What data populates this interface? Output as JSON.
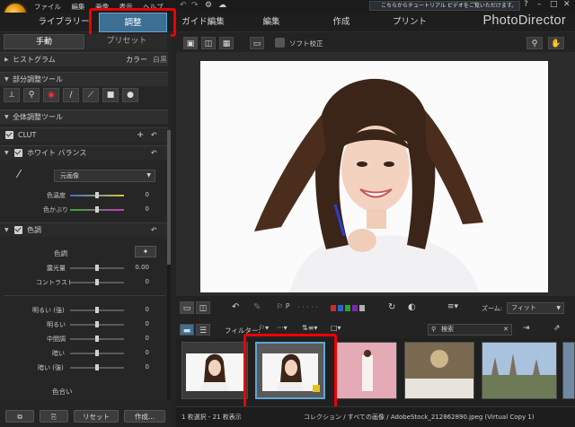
{
  "menu": [
    "ファイル",
    "編集",
    "画像",
    "表示",
    "ヘルプ"
  ],
  "tip": "こちらからチュートリアル ビデオをご覧いただけます。",
  "nav": [
    "ライブラリー",
    "調整",
    "ガイド編集",
    "編集",
    "作成",
    "プリント"
  ],
  "brand": "PhotoDirector",
  "left": {
    "tabs": [
      "手動",
      "プリセット"
    ],
    "histogram": {
      "title": "ヒストグラム",
      "opt1": "カラー",
      "opt2": "白黒"
    },
    "local_tools": "部分調整ツール",
    "global_tools": "全体調整ツール",
    "clut": "CLUT",
    "wb": {
      "title": "ホワイト バランス",
      "preset": "元画像",
      "temp": "色温度",
      "tint": "色かぶり",
      "temp_val": "0",
      "tint_val": "0"
    },
    "tone": {
      "title": "色調",
      "sub": "色調",
      "exposure": "露光量",
      "exposure_val": "0.00",
      "contrast": "コントラスト",
      "contrast_val": "0"
    },
    "tone_rows": [
      {
        "label": "明るい (強)",
        "val": "0"
      },
      {
        "label": "明るい",
        "val": "0"
      },
      {
        "label": "中間調",
        "val": "0"
      },
      {
        "label": "暗い",
        "val": "0"
      },
      {
        "label": "暗い (強)",
        "val": "0"
      }
    ],
    "hue": "色合い",
    "reset": "リセット",
    "create": "作成..."
  },
  "toolbar": {
    "softproof": "ソフト校正",
    "zoom_label": "ズーム:",
    "zoom_value": "フィット",
    "filter": "フィルター:",
    "search": "検索"
  },
  "colors": {
    "accent": "#3d6f93",
    "highlight": "#e00000",
    "flags": [
      "#d12a2a",
      "#2f64c8",
      "#2aa82a",
      "#7a2ab0",
      "#b0b0b0"
    ]
  },
  "status": {
    "selection": "1 枚選択 - 21 枚表示",
    "path": "コレクション / すべての画像 / AdobeStock_212862890.jpeg (Virtual Copy 1)"
  }
}
